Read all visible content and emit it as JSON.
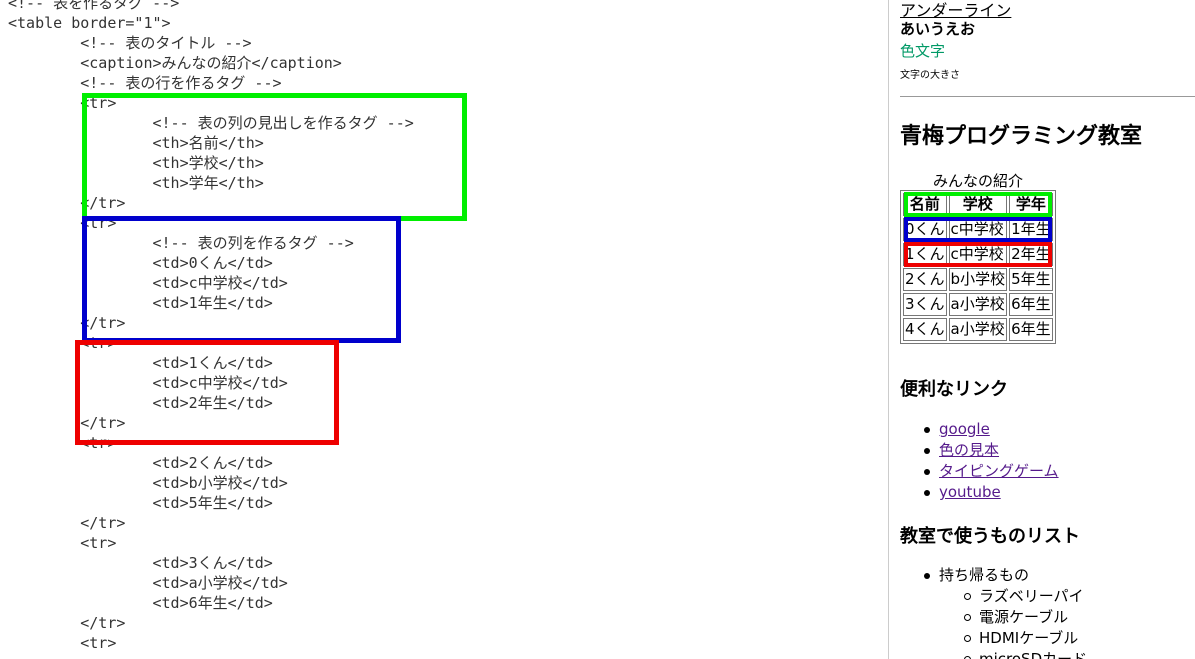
{
  "code_editor": {
    "lines": [
      "<!-- 表を作るタグ -->",
      "<table border=\"1\">",
      "        <!-- 表のタイトル -->",
      "        <caption>みんなの紹介</caption>",
      "        <!-- 表の行を作るタグ -->",
      "        <tr>",
      "                <!-- 表の列の見出しを作るタグ -->",
      "                <th>名前</th>",
      "                <th>学校</th>",
      "                <th>学年</th>",
      "        </tr>",
      "        <tr>",
      "                <!-- 表の列を作るタグ -->",
      "                <td>0くん</td>",
      "                <td>c中学校</td>",
      "                <td>1年生</td>",
      "        </tr>",
      "        <tr>",
      "                <td>1くん</td>",
      "                <td>c中学校</td>",
      "                <td>2年生</td>",
      "        </tr>",
      "        <tr>",
      "                <td>2くん</td>",
      "                <td>b小学校</td>",
      "                <td>5年生</td>",
      "        </tr>",
      "        <tr>",
      "                <td>3くん</td>",
      "                <td>a小学校</td>",
      "                <td>6年生</td>",
      "        </tr>",
      "        <tr>"
    ]
  },
  "highlight_colors": {
    "header_row": "#00ee00",
    "row_1": "#0000cc",
    "row_2": "#ee0000"
  },
  "preview": {
    "underline_text": "アンダーライン",
    "bold_text": "あいうえお",
    "color_text": "色文字",
    "color_text_color": "#009966",
    "small_text": "文字の大きさ",
    "heading": "青梅プログラミング教室",
    "table": {
      "caption": "みんなの紹介",
      "headers": [
        "名前",
        "学校",
        "学年"
      ],
      "rows": [
        [
          "0くん",
          "c中学校",
          "1年生"
        ],
        [
          "1くん",
          "c中学校",
          "2年生"
        ],
        [
          "2くん",
          "b小学校",
          "5年生"
        ],
        [
          "3くん",
          "a小学校",
          "6年生"
        ],
        [
          "4くん",
          "a小学校",
          "6年生"
        ]
      ]
    },
    "links_heading": "便利なリンク",
    "links": [
      "google",
      "色の見本",
      "タイピングゲーム",
      "youtube"
    ],
    "items_heading": "教室で使うものリスト",
    "items": [
      "持ち帰るもの"
    ],
    "sub_items": [
      "ラズベリーパイ",
      "電源ケーブル",
      "HDMIケーブル",
      "microSDカード"
    ]
  }
}
